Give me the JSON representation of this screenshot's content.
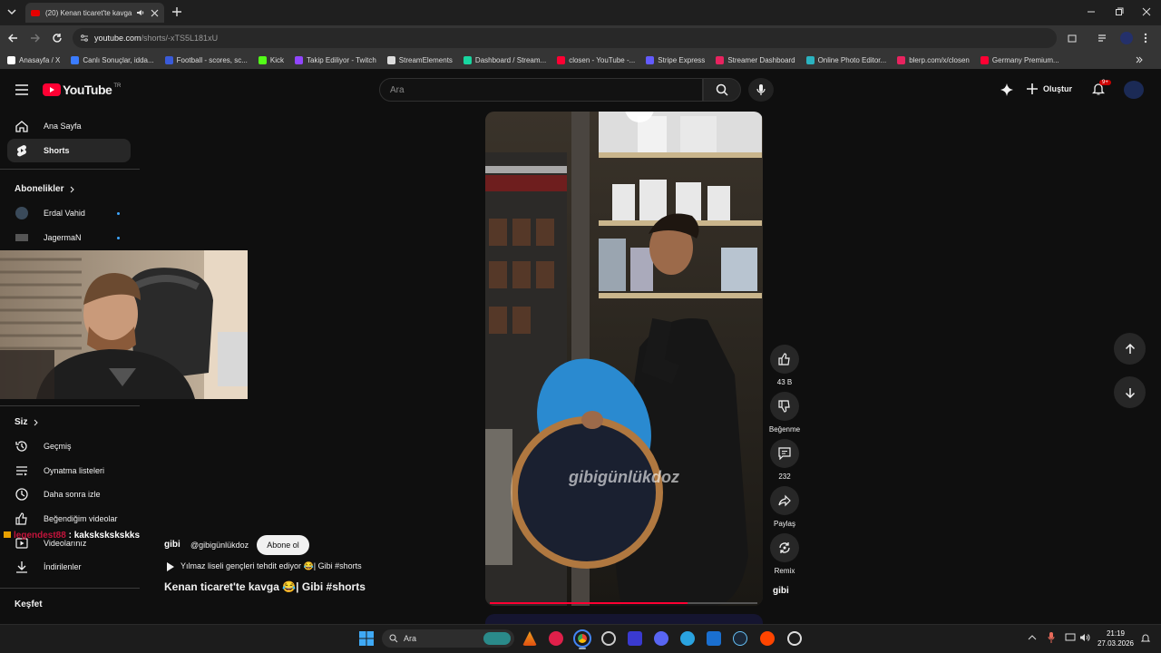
{
  "browser": {
    "tab_title": "(20) Kenan ticaret'te kavga",
    "url_host": "youtube.com",
    "url_path": "/shorts/-xTS5L181xU",
    "bookmarks": [
      {
        "label": "Anasayfa / X",
        "color": "#ffffff"
      },
      {
        "label": "Canlı Sonuçlar, idda...",
        "color": "#3b7cff"
      },
      {
        "label": "Football - scores, sc...",
        "color": "#3a5bd9"
      },
      {
        "label": "Kick",
        "color": "#53fc18"
      },
      {
        "label": "Takip Ediliyor - Twitch",
        "color": "#9146ff"
      },
      {
        "label": "StreamElements",
        "color": "#dddddd"
      },
      {
        "label": "Dashboard / Stream...",
        "color": "#18d6a0"
      },
      {
        "label": "closen - YouTube -...",
        "color": "#ff0033"
      },
      {
        "label": "Stripe Express",
        "color": "#635bff"
      },
      {
        "label": "Streamer Dashboard",
        "color": "#e8235f"
      },
      {
        "label": "Online Photo Editor...",
        "color": "#2bb3c0"
      },
      {
        "label": "blerp.com/x/closen",
        "color": "#e8235f"
      },
      {
        "label": "Germany Premium...",
        "color": "#ff0033"
      }
    ]
  },
  "header": {
    "logo_text": "YouTube",
    "region": "TR",
    "search_placeholder": "Ara",
    "create_label": "Oluştur",
    "notif_count": "9+"
  },
  "sidebar": {
    "home": "Ana Sayfa",
    "shorts": "Shorts",
    "subscriptions_heading": "Abonelikler",
    "subscriptions": [
      "Erdal Vahid",
      "JagermaN"
    ],
    "you_heading": "Siz",
    "you_items": [
      "Geçmiş",
      "Oynatma listeleri",
      "Daha sonra izle",
      "Beğendiğim videolar",
      "Videolarınız",
      "İndirilenler"
    ],
    "explore_heading": "Keşfet"
  },
  "video": {
    "watermark": "gibigünlükdoz",
    "progress_fraction": 0.74
  },
  "actions": {
    "likes": "43 B",
    "dislike": "Beğenme",
    "comments": "232",
    "share": "Paylaş",
    "remix": "Remix",
    "channel_badge": "gibi"
  },
  "channel": {
    "logo": "gibi",
    "handle": "@gibigünlükdoz",
    "subscribe": "Abone ol",
    "playlist": "Yılmaz liseli gençleri tehdit ediyor 😂| Gibi #shorts",
    "title": "Kenan ticaret'te kavga 😂| Gibi #shorts"
  },
  "chat": {
    "user": "legendest88",
    "message": "kakskskskskks"
  },
  "taskbar": {
    "search": "Ara",
    "time": "21:19",
    "date": "27.03.2026"
  }
}
